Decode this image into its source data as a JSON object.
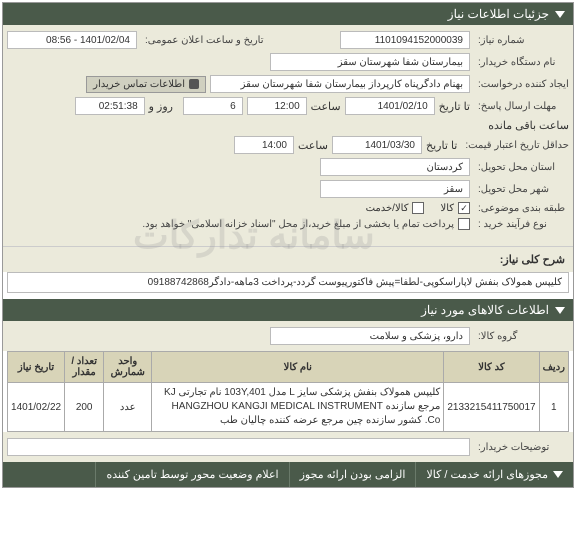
{
  "header": {
    "title": "جزئیات اطلاعات نیاز"
  },
  "form": {
    "req_no_label": "شماره نیاز:",
    "req_no": "1101094152000039",
    "announce_label": "تاریخ و ساعت اعلان عمومی:",
    "announce_val": "1401/02/04 - 08:56",
    "buyer_label": "نام دستگاه خریدار:",
    "buyer_val": "بیمارستان شفا شهرستان سقز",
    "creator_label": "ایجاد کننده درخواست:",
    "creator_val": "بهنام دادگرپناه کارپرداز بیمارستان شفا شهرستان سقز",
    "contact_btn": "اطلاعات تماس خریدار",
    "deadline_label": "مهلت ارسال پاسخ:",
    "deadline_date_label": "تا تاریخ",
    "deadline_date": "1401/02/10",
    "deadline_time_label": "ساعت",
    "deadline_time": "12:00",
    "day_label": "روز و",
    "day_val": "6",
    "remain_label": "ساعت باقی مانده",
    "remain_time": "02:51:38",
    "validity_label": "حداقل تاریخ اعتبار قیمت:",
    "validity_date_label": "تا تاریخ",
    "validity_date": "1401/03/30",
    "validity_time_label": "ساعت",
    "validity_time": "14:00",
    "province_label": "استان محل تحویل:",
    "province_val": "کردستان",
    "city_label": "شهر محل تحویل:",
    "city_val": "سقز",
    "category_label": "طبقه بندی موضوعی:",
    "cat_kala": "کالا",
    "cat_khedmat": "کالا/خدمت",
    "process_label": "نوع فرآیند خرید :",
    "process_note": "پرداخت تمام یا بخشی از مبلغ خرید،از محل \"اسناد خزانه اسلامی\" خواهد بود.",
    "summary_label": "شرح کلی نیاز:",
    "summary_val": "کلیپس همولاک بنفش لاپاراسکوپی-لطفا=پیش فاکتورپیوست گردد-پرداخت 3ماهه-دادگر09188742868"
  },
  "items_header": "اطلاعات کالاهای مورد نیاز",
  "group_label": "گروه کالا:",
  "group_val": "دارو، پزشکی و سلامت",
  "buyer_desc_label": "توضیحات خریدار:",
  "table": {
    "headers": [
      "ردیف",
      "کد کالا",
      "نام کالا",
      "واحد شمارش",
      "تعداد / مقدار",
      "تاریخ نیاز"
    ],
    "rows": [
      {
        "idx": "1",
        "code": "2133215411750017",
        "name": "کلیپس همولاک بنفش پزشکی سایز L مدل 103Y,401 نام تجارتی KJ مرجع سازنده HANGZHOU KANGJI MEDICAL INSTRUMENT Co. کشور سازنده چین مرجع عرضه کننده چالیان طب",
        "unit": "عدد",
        "qty": "200",
        "date": "1401/02/22"
      }
    ]
  },
  "footer": {
    "tab1": "مجوزهای ارائه خدمت / کالا",
    "tab2": "الزامی بودن ارائه مجوز",
    "tab3": "اعلام وضعیت محور توسط تامین کننده"
  },
  "watermark": "سامانه تدارکات"
}
